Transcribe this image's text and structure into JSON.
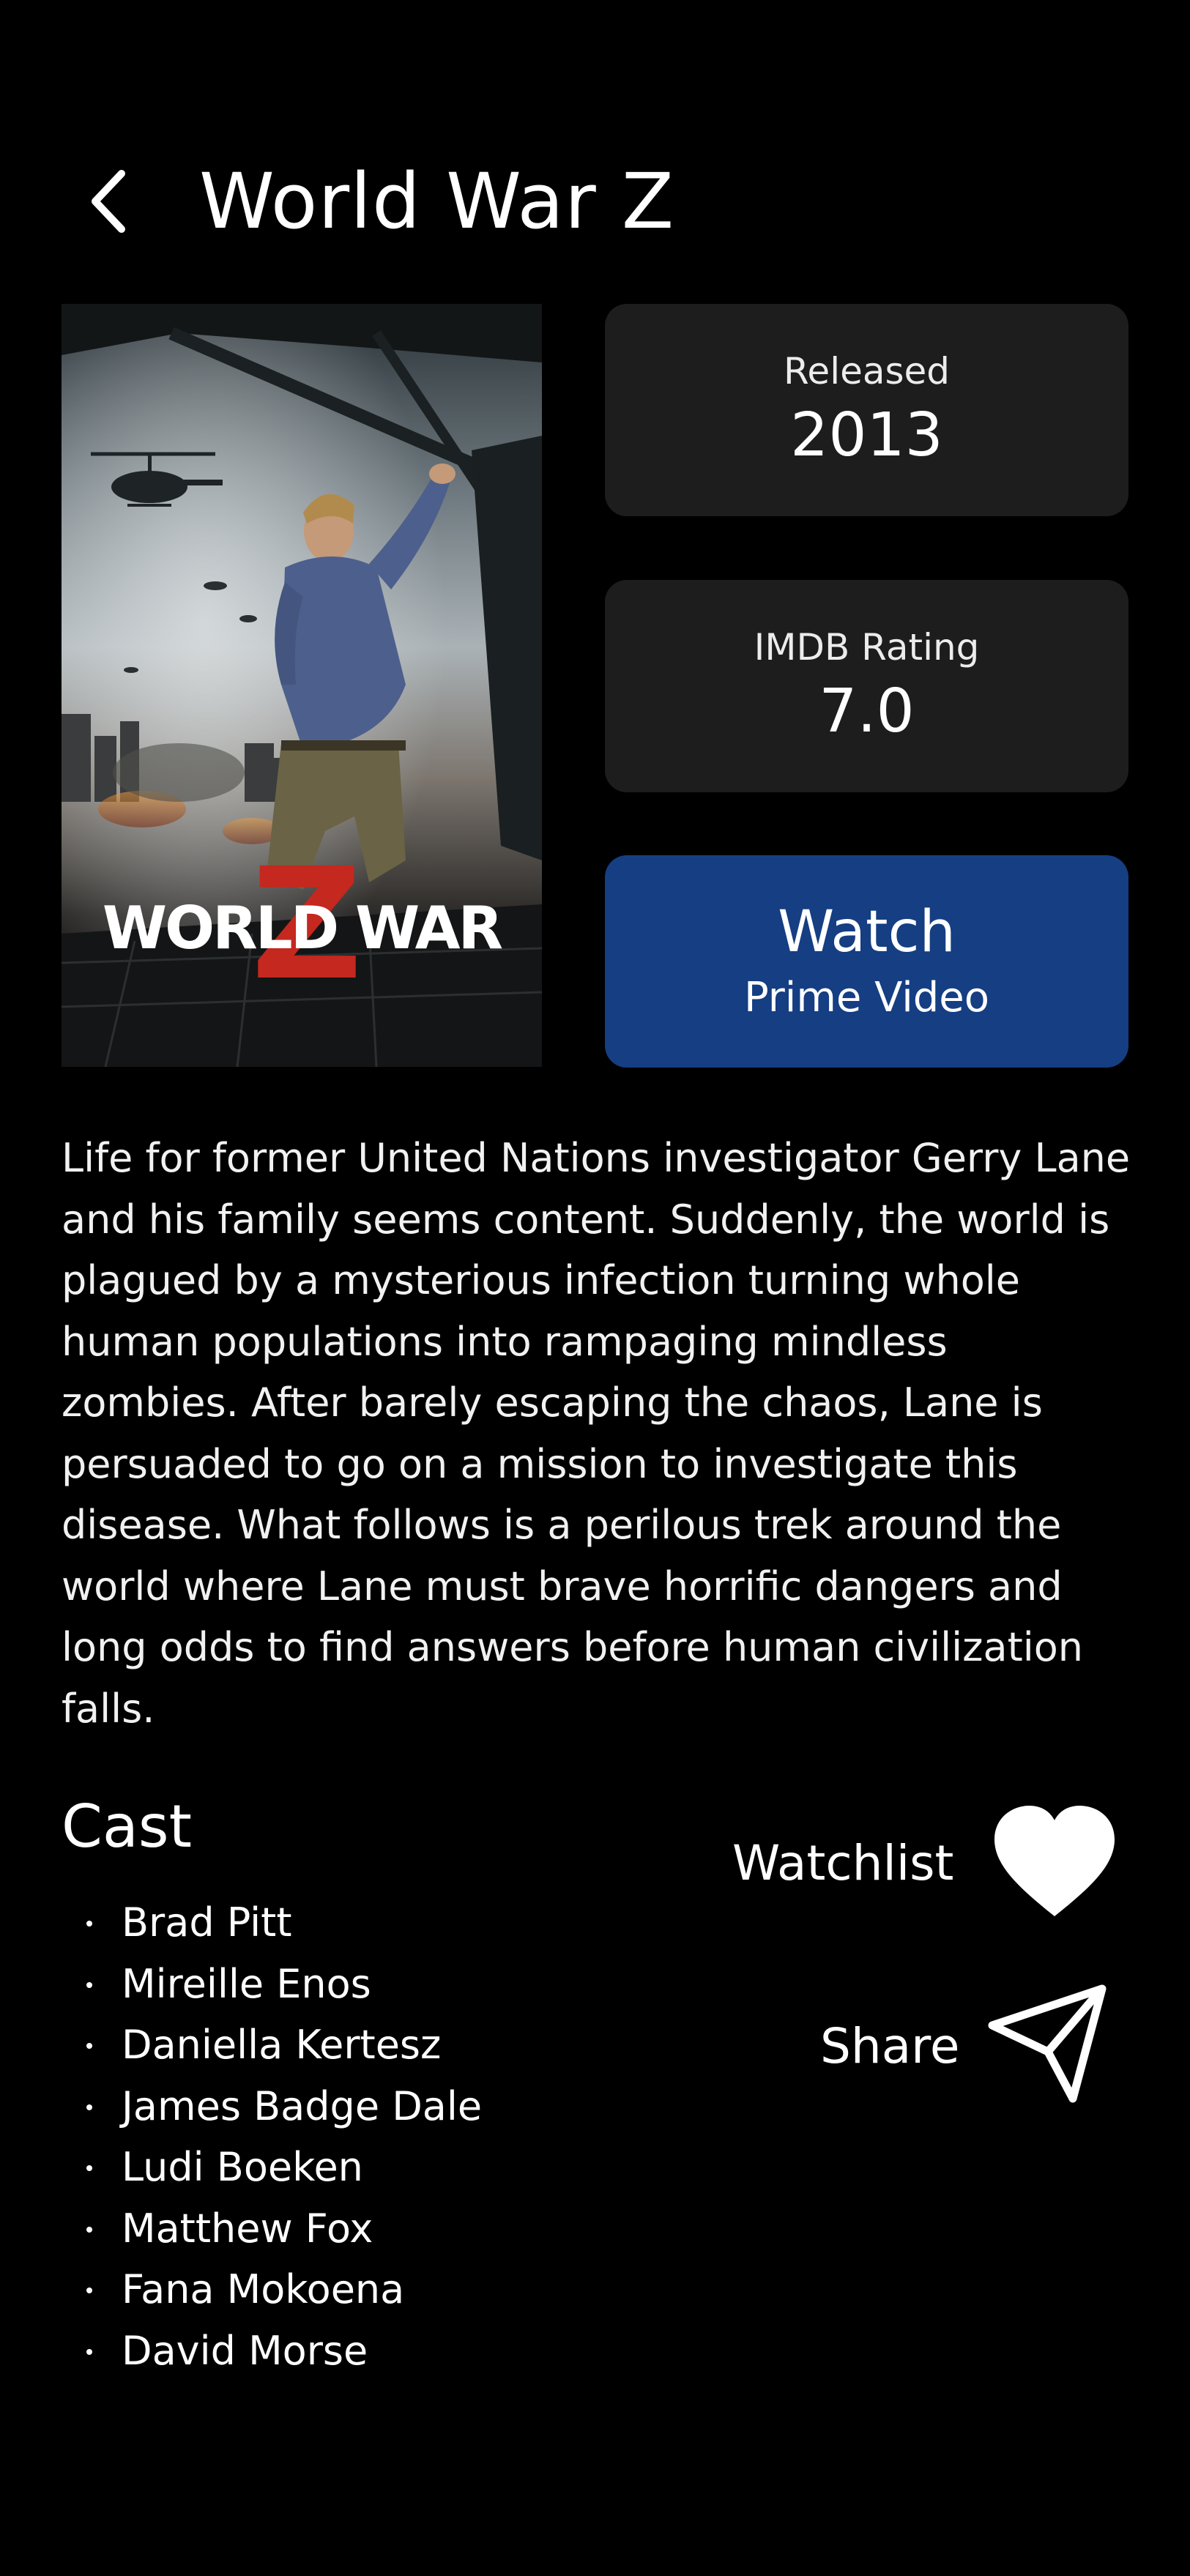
{
  "header": {
    "back_icon": "chevron-left-icon",
    "title": "World War Z"
  },
  "poster": {
    "title_text": "WORLD WAR Z"
  },
  "info": {
    "released_label": "Released",
    "released_value": "2013",
    "rating_label": "IMDB Rating",
    "rating_value": "7.0"
  },
  "watch": {
    "label": "Watch",
    "provider": "Prime Video",
    "color": "#153e83"
  },
  "synopsis": "Life for former United Nations investigator Gerry Lane and his family seems content. Suddenly, the world is plagued by a mysterious infection turning whole human populations into rampaging mindless zombies. After barely escaping the chaos, Lane is persuaded to go on a mission to investigate this disease. What follows is a perilous trek around the world where Lane must brave horrific dangers and long odds to find answers before human civilization falls.",
  "cast": {
    "heading": "Cast",
    "members": [
      "Brad Pitt",
      "Mireille Enos",
      "Daniella Kertesz",
      "James Badge Dale",
      "Ludi Boeken",
      "Matthew Fox",
      "Fana Mokoena",
      "David Morse"
    ]
  },
  "actions": {
    "watchlist_label": "Watchlist",
    "watchlist_icon": "heart-icon",
    "share_label": "Share",
    "share_icon": "send-icon"
  }
}
